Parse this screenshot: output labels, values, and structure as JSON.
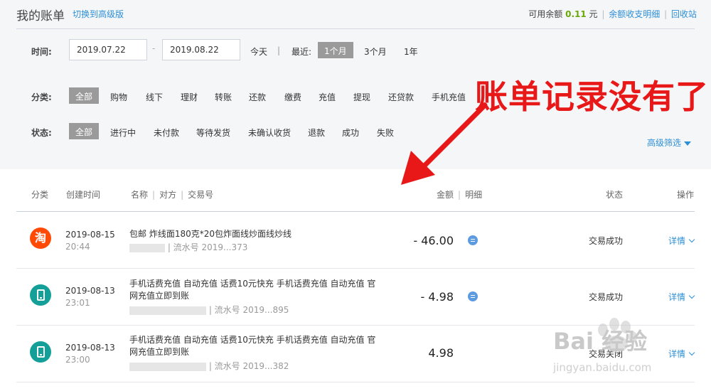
{
  "header": {
    "title": "我的账单",
    "switch_link": "切换到高级版",
    "balance_label": "可用余额",
    "balance_value": "0.11",
    "balance_unit": "元",
    "balance_detail_link": "余额收支明细",
    "recycle_link": "回收站"
  },
  "filters": {
    "time_label": "时间:",
    "date_from": "2019.07.22",
    "date_sep": "-",
    "date_to": "2019.08.22",
    "today": "今天",
    "recent_label": "最近:",
    "ranges": [
      "1个月",
      "3个月",
      "1年"
    ],
    "selected_range": "1个月",
    "category_label": "分类:",
    "categories": [
      "全部",
      "购物",
      "线下",
      "理财",
      "转账",
      "还款",
      "缴费",
      "充值",
      "提现",
      "还贷款",
      "手机充值"
    ],
    "status_label": "状态:",
    "statuses": [
      "全部",
      "进行中",
      "未付款",
      "等待发货",
      "未确认收货",
      "退款",
      "成功",
      "失败"
    ],
    "advanced_filter": "高级筛选"
  },
  "table": {
    "headers": {
      "category": "分类",
      "created": "创建时间",
      "name": "名称",
      "counterparty": "对方",
      "trade_no": "交易号",
      "amount": "金额",
      "detail": "明细",
      "status": "状态",
      "action": "操作"
    },
    "rows": [
      {
        "icon": "taobao-icon",
        "icon_char": "淘",
        "date": "2019-08-15",
        "time": "20:44",
        "name": "包邮 炸线面180克*20包炸面线炒面线炒线",
        "serial": "| 流水号 2019...373",
        "amount": "- 46.00",
        "has_detail": true,
        "status": "交易成功",
        "action": "详情"
      },
      {
        "icon": "phone-icon",
        "date": "2019-08-13",
        "time": "23:01",
        "name": "手机话费充值 自动充值   话费10元快充 手机话费充值 自动充值 官网充值立即到账",
        "serial": "| 流水号 2019...895",
        "amount": "- 4.98",
        "has_detail": true,
        "status": "交易成功",
        "action": "详情"
      },
      {
        "icon": "phone-icon",
        "date": "2019-08-13",
        "time": "23:00",
        "name": "手机话费充值 自动充值   话费10元快充 手机话费充值 自动充值 官网充值立即到账",
        "serial": "| 流水号 2019...382",
        "amount": "4.98",
        "has_detail": false,
        "status": "交易关闭",
        "action": "详情"
      }
    ]
  },
  "annotation": {
    "text": "账单记录没有了",
    "color": "#e81818"
  },
  "watermark": {
    "text": "Bai 经验",
    "url": "jingyan.baidu.com"
  },
  "colors": {
    "link": "#2c8fd6",
    "balance": "#6aa80a",
    "pill": "#9a9a9a",
    "taobao": "#ff4a06",
    "phone": "#14a098"
  }
}
